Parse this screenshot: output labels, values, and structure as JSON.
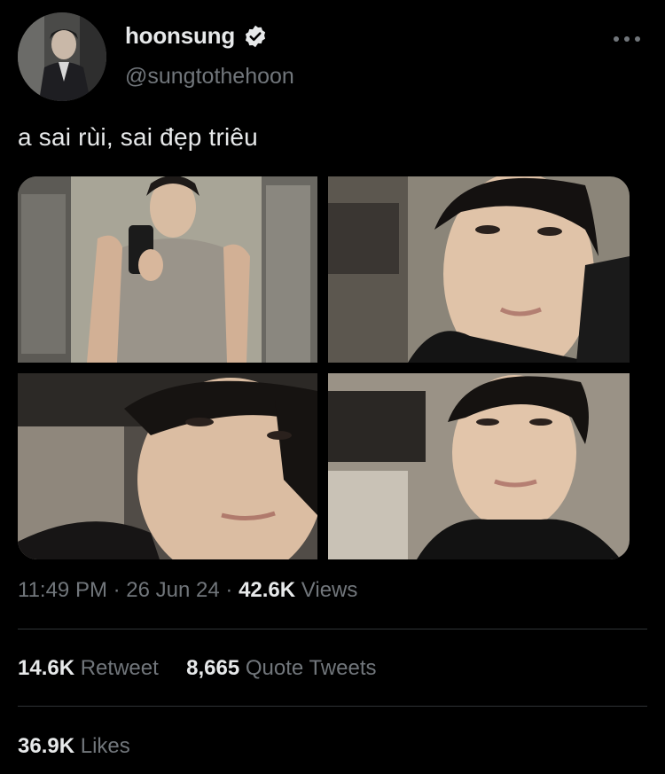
{
  "user": {
    "display_name": "hoonsung",
    "handle": "@sungtothehoon",
    "verified": true
  },
  "tweet": {
    "text": "a sai rùi, sai đẹp triêu",
    "media_count": 4
  },
  "meta": {
    "time": "11:49 PM",
    "sep1": "·",
    "date": "26 Jun 24",
    "sep2": "·",
    "views_count": "42.6K",
    "views_label": "Views"
  },
  "stats": {
    "retweets_count": "14.6K",
    "retweets_label": "Retweet",
    "quotes_count": "8,665",
    "quotes_label": "Quote Tweets",
    "likes_count": "36.9K",
    "likes_label": "Likes"
  },
  "icons": {
    "verified": "verified-badge-icon",
    "more": "more-options-icon"
  },
  "colors": {
    "background": "#000000",
    "primary_text": "#e7e9ea",
    "secondary_text": "#71767b",
    "divider": "#2f3336"
  }
}
